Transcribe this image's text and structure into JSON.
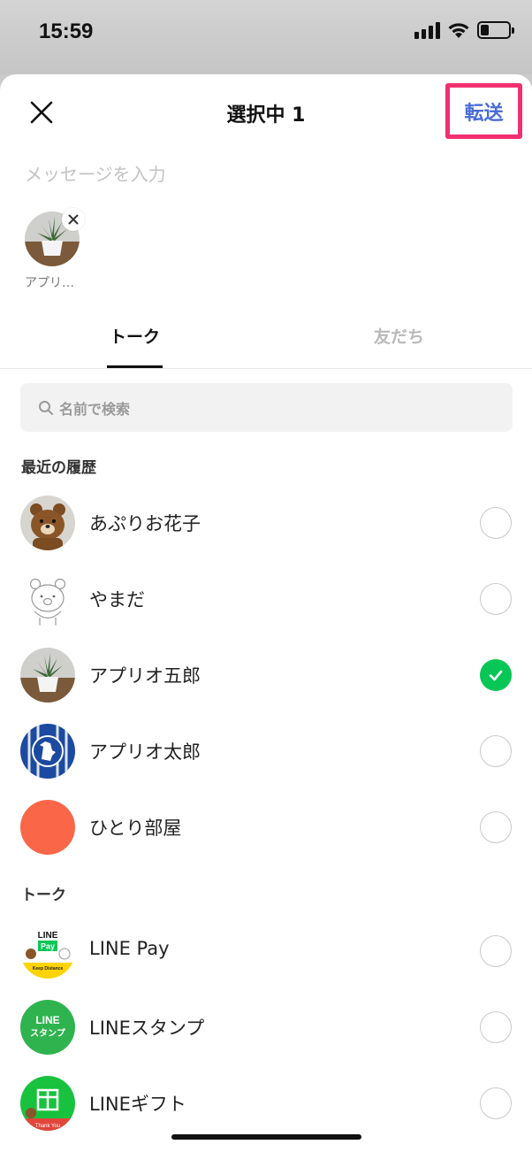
{
  "status_bar": {
    "time": "15:59"
  },
  "header": {
    "title": "選択中 1",
    "forward_label": "転送"
  },
  "message": {
    "placeholder": "メッセージを入力"
  },
  "selected": [
    {
      "label": "アプリ…"
    }
  ],
  "tabs": [
    {
      "label": "トーク",
      "active": true
    },
    {
      "label": "友だち",
      "active": false
    }
  ],
  "search": {
    "placeholder": "名前で検索"
  },
  "sections": {
    "recent": "最近の履歴",
    "talk": "トーク"
  },
  "recent_items": [
    {
      "name": "あぷりお花子",
      "checked": false,
      "avatar": "bear-icon"
    },
    {
      "name": "やまだ",
      "checked": false,
      "avatar": "bear-outline-icon"
    },
    {
      "name": "アプリオ五郎",
      "checked": true,
      "avatar": "plant-icon"
    },
    {
      "name": "アプリオ太郎",
      "checked": false,
      "avatar": "football-crest-icon"
    },
    {
      "name": "ひとり部屋",
      "checked": false,
      "avatar": "orange-circle-icon"
    }
  ],
  "talk_items": [
    {
      "name": "LINE Pay",
      "checked": false,
      "avatar": "line-pay-logo",
      "logo_text": "LINE",
      "logo_sub": "Pay",
      "logo_foot": "Keep Distance"
    },
    {
      "name": "LINEスタンプ",
      "checked": false,
      "avatar": "line-stamp-logo",
      "logo_text": "LINE",
      "logo_sub": "スタンプ"
    },
    {
      "name": "LINEギフト",
      "checked": false,
      "avatar": "line-gift-logo",
      "logo_foot": "Thank You"
    }
  ],
  "colors": {
    "accent_blue": "#4a6cd6",
    "highlight_pink": "#f0306f",
    "check_green": "#06c755"
  }
}
